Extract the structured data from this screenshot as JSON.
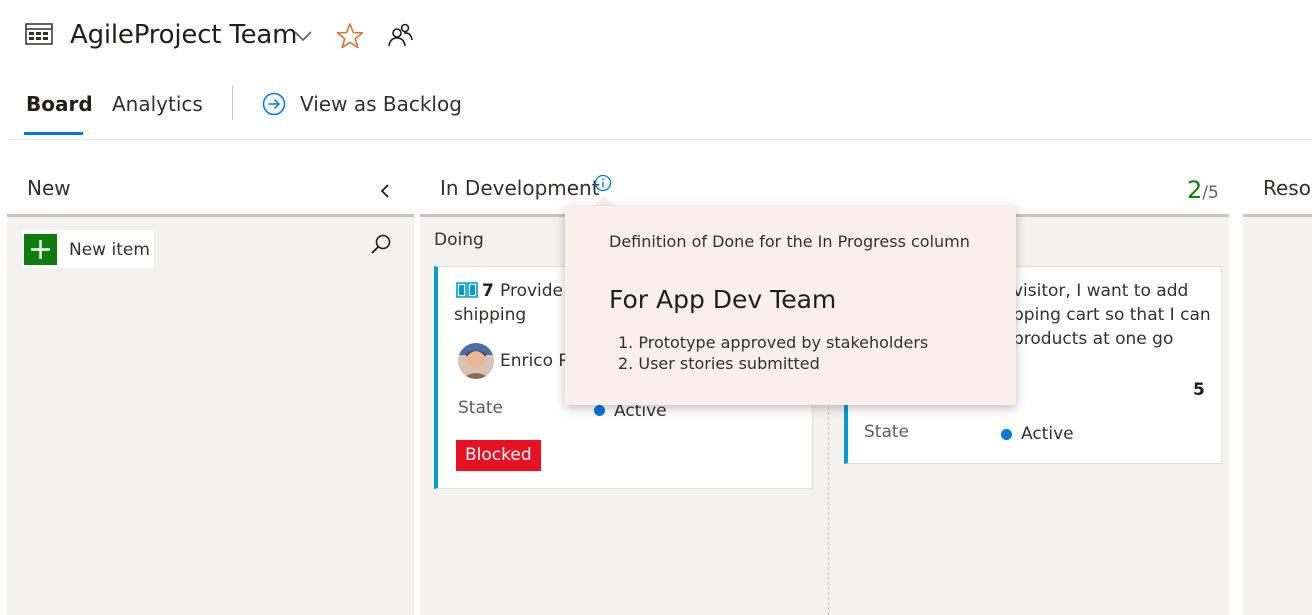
{
  "header": {
    "team_name": "AgileProject Team",
    "icons": [
      "board-icon",
      "chevron-down-icon",
      "star-icon",
      "team-members-icon"
    ],
    "accent": "#0078d4",
    "star_color": "#d1763d"
  },
  "tabs": {
    "items": [
      {
        "label": "Board",
        "selected": true
      },
      {
        "label": "Analytics",
        "selected": false
      }
    ],
    "backlog_label": "View as Backlog"
  },
  "columns": [
    {
      "title": "New",
      "new_item_label": "New item"
    },
    {
      "title": "In Development",
      "count": "2",
      "limit": "/5",
      "split_label": "Doing"
    },
    {
      "title": "Resol"
    }
  ],
  "cards": [
    {
      "id": "7",
      "title_line1": "Provide",
      "title_line2": "shipping",
      "assignee": "Enrico Ro",
      "state_label": "State",
      "state_value": "Active",
      "tag": "Blocked",
      "tag_color": "#e81123"
    },
    {
      "title_line1": "visitor, I want to add",
      "title_line2": "pping cart so that I can",
      "title_line3": "products at one go",
      "effort": "5",
      "state_label": "State",
      "state_value": "Active"
    }
  ],
  "popup": {
    "subtitle": "Definition of Done for the In Progress column",
    "title": "For App Dev Team",
    "items": [
      "1. Prototype approved by stakeholders",
      "2. User stories submitted"
    ]
  }
}
